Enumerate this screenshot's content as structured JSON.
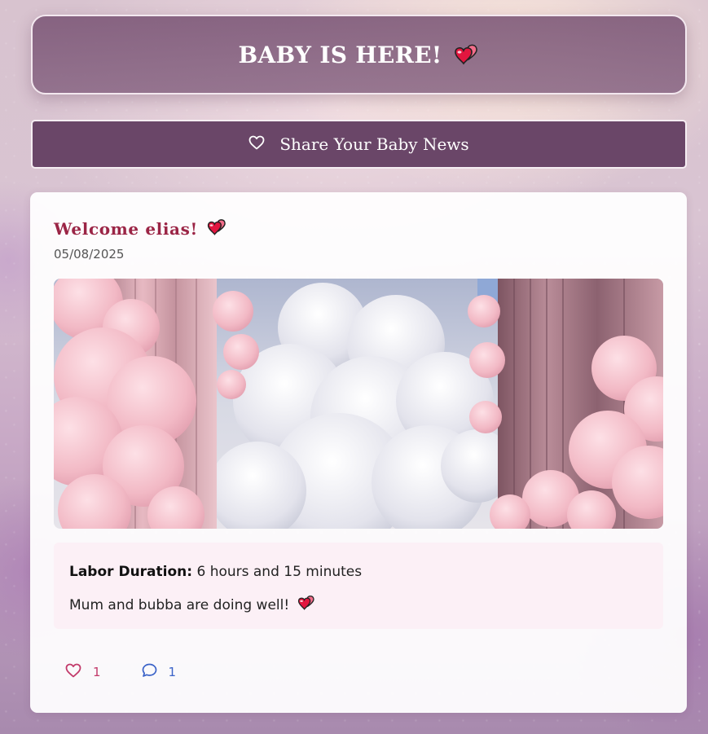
{
  "header": {
    "title": "BABY IS HERE!",
    "emoji": "two-hearts-icon"
  },
  "share_button": {
    "label": "Share Your Baby News",
    "icon": "heart-outline-icon"
  },
  "post": {
    "title": "Welcome elias!",
    "title_emoji": "two-hearts-icon",
    "date": "05/08/2025",
    "image": "pink-clouds-pillars-image",
    "labor_label": "Labor Duration:",
    "labor_value": "6 hours and 15 minutes",
    "message": "Mum and bubba are doing well!",
    "message_emoji": "two-hearts-icon",
    "likes": "1",
    "comments": "1"
  },
  "colors": {
    "header_bg": "#7d5676",
    "button_bg": "#6a4668",
    "title_accent": "#9b2546",
    "like_color": "#c23a6a",
    "comment_color": "#3b63c8",
    "details_bg": "#fcf0f6"
  }
}
